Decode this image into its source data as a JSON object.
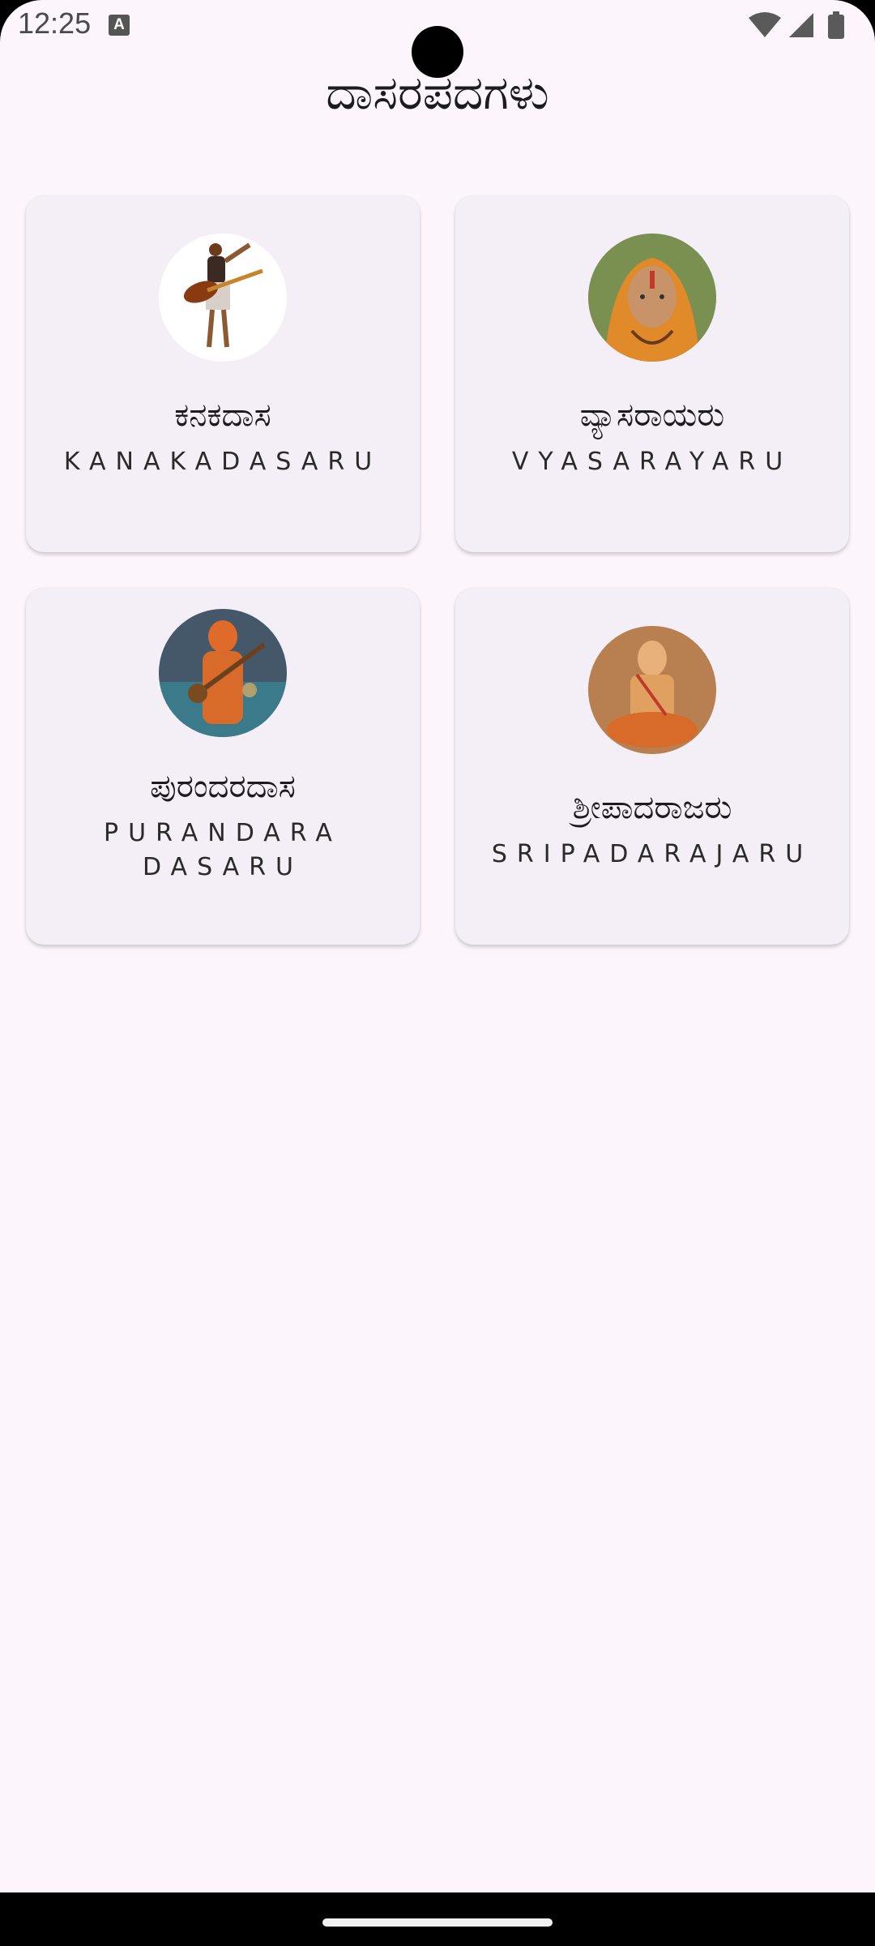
{
  "status_bar": {
    "time": "12:25",
    "notification_icon_letter": "A",
    "icons": [
      "wifi-icon",
      "cell-signal-icon",
      "battery-icon"
    ]
  },
  "header": {
    "title": "ದಾಸರಪದಗಳು"
  },
  "cards": [
    {
      "title": "ಕನಕದಾಸ",
      "subtitle": "KANAKADASARU",
      "avatar_icon": "kanakadasa-portrait"
    },
    {
      "title": "ವ್ಯಾಸರಾಯರು",
      "subtitle": "VYASARAYARU",
      "avatar_icon": "vyasaraya-portrait"
    },
    {
      "title": "ಪುರಂದರದಾಸ",
      "subtitle": "PURANDARA DASARU",
      "avatar_icon": "purandaradasa-portrait"
    },
    {
      "title": "ಶ್ರೀಪಾದರಾಜರು",
      "subtitle": "SRIPADARAJARU",
      "avatar_icon": "sripadaraja-portrait"
    }
  ],
  "colors": {
    "background": "#fcf6fc",
    "card": "#f4eff6",
    "text": "#1c1b1f"
  }
}
